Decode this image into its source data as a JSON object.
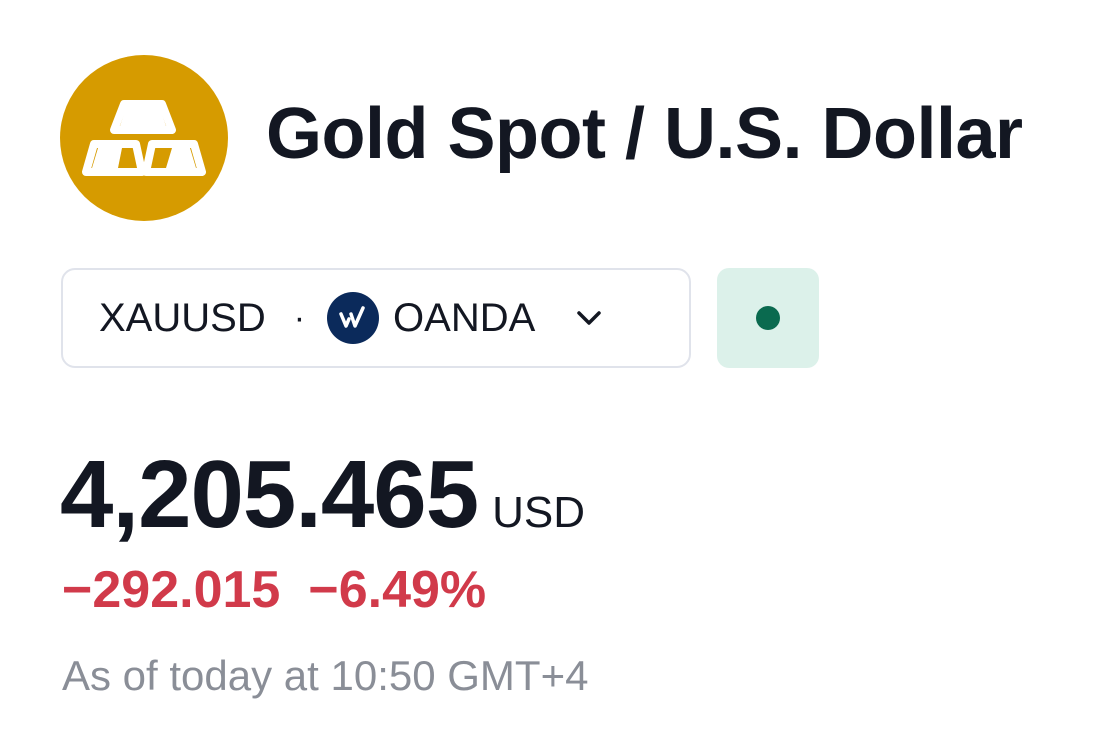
{
  "header": {
    "title": "Gold Spot / U.S. Dollar",
    "logo_icon": "gold-bars-icon",
    "logo_color": "#d69b00"
  },
  "symbol": {
    "ticker": "XAUUSD",
    "separator": "·",
    "broker_icon": "oanda-logo-icon",
    "broker": "OANDA",
    "dropdown_icon": "chevron-down-icon"
  },
  "market_status": {
    "icon": "status-dot-icon",
    "color": "#0a6a4f",
    "background": "#dcf1ea"
  },
  "quote": {
    "price": "4,205.465",
    "currency": "USD",
    "change": "−292.015",
    "change_percent": "−6.49%",
    "change_color": "#d13a4a",
    "as_of": "As of today at 10:50 GMT+4"
  }
}
